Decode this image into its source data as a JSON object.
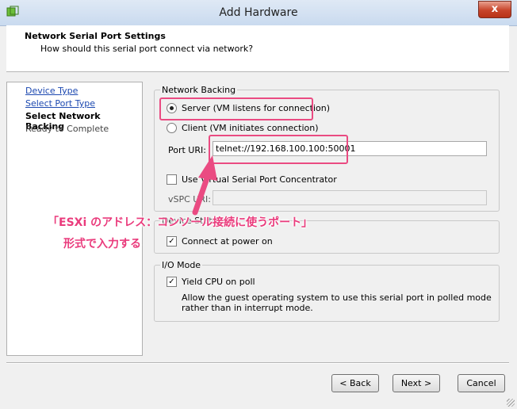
{
  "window": {
    "title": "Add Hardware",
    "close_glyph": "x",
    "app_icon": "vsphere-hardware-icon"
  },
  "header": {
    "title": "Network Serial Port Settings",
    "subtitle": "How should this serial port connect via network?"
  },
  "nav": {
    "items": [
      {
        "label": "Device Type",
        "state": "link"
      },
      {
        "label": "Select Port Type",
        "state": "link"
      },
      {
        "label": "Select Network Backing",
        "state": "current"
      },
      {
        "label": "Ready to Complete",
        "state": "disabled"
      }
    ]
  },
  "network_backing": {
    "legend": "Network Backing",
    "server_label": "Server (VM listens for connection)",
    "server_selected": true,
    "client_label": "Client   (VM initiates connection)",
    "client_selected": false,
    "port_uri_label": "Port URI:",
    "port_uri_value": "telnet://192.168.100.100:50001",
    "vspc_checkbox_label": "Use Virtual Serial Port Concentrator",
    "vspc_checked": false,
    "vspc_uri_label": "vSPC URI:",
    "vspc_uri_value": ""
  },
  "device_status": {
    "legend": "Device Status",
    "connect_label": "Connect at power on",
    "connect_checked": true
  },
  "io_mode": {
    "legend": "I/O Mode",
    "yield_label": "Yield CPU on poll",
    "yield_checked": true,
    "description_line1": "Allow the guest operating system to use this serial port in polled mode",
    "description_line2": "rather than in interrupt mode."
  },
  "annotation": {
    "line1": "「ESXi のアドレス：コンソール接続に使うポート」",
    "line2": "形式で入力する",
    "color": "#ea4b82"
  },
  "buttons": {
    "back": "< Back",
    "next": "Next >",
    "cancel": "Cancel"
  },
  "colors": {
    "link": "#1c48b0",
    "highlight": "#ea4b82"
  }
}
